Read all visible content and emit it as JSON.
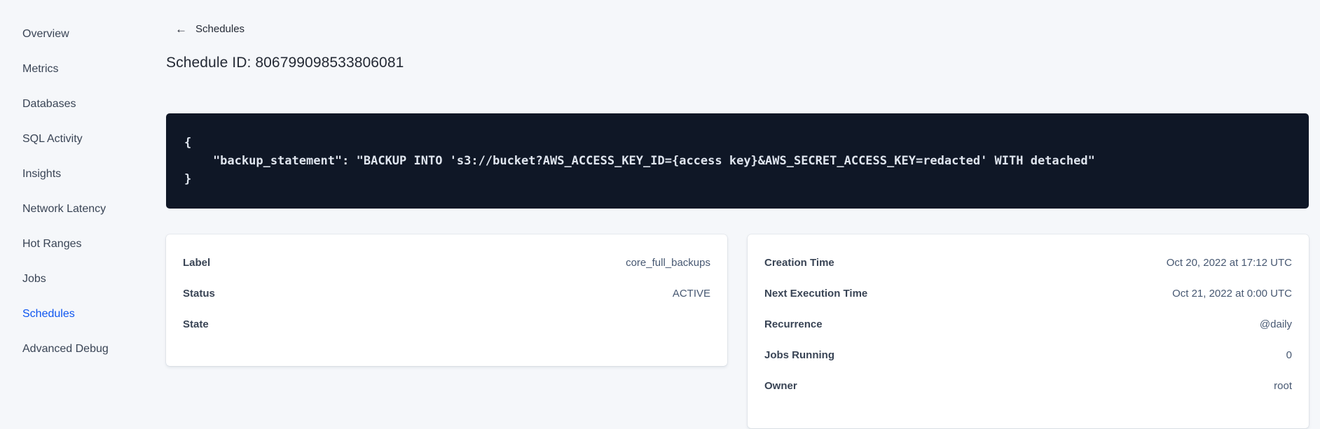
{
  "sidebar": {
    "items": [
      {
        "label": "Overview",
        "active": false
      },
      {
        "label": "Metrics",
        "active": false
      },
      {
        "label": "Databases",
        "active": false
      },
      {
        "label": "SQL Activity",
        "active": false
      },
      {
        "label": "Insights",
        "active": false
      },
      {
        "label": "Network Latency",
        "active": false
      },
      {
        "label": "Hot Ranges",
        "active": false
      },
      {
        "label": "Jobs",
        "active": false
      },
      {
        "label": "Schedules",
        "active": true
      },
      {
        "label": "Advanced Debug",
        "active": false
      }
    ]
  },
  "header": {
    "back_arrow": "←",
    "back_label": "Schedules",
    "title": "Schedule ID: 806799098533806081"
  },
  "code_block": {
    "lines": [
      "{",
      "    \"backup_statement\": \"BACKUP INTO 's3://bucket?AWS_ACCESS_KEY_ID={access key}&AWS_SECRET_ACCESS_KEY=redacted' WITH detached\"",
      "}"
    ]
  },
  "details_card": {
    "rows": [
      {
        "label": "Label",
        "value": "core_full_backups"
      },
      {
        "label": "Status",
        "value": "ACTIVE"
      },
      {
        "label": "State",
        "value": ""
      }
    ]
  },
  "schedule_card": {
    "rows": [
      {
        "label": "Creation Time",
        "value": "Oct 20, 2022 at 17:12 UTC"
      },
      {
        "label": "Next Execution Time",
        "value": "Oct 21, 2022 at 0:00 UTC"
      },
      {
        "label": "Recurrence",
        "value": "@daily"
      },
      {
        "label": "Jobs Running",
        "value": "0"
      },
      {
        "label": "Owner",
        "value": "root"
      }
    ]
  },
  "colors": {
    "page_background": "#f5f7fa",
    "sidebar_text": "#394455",
    "active_link_blue": "#0d55f0",
    "code_background": "#0f1726",
    "code_text": "#dfe5ee",
    "card_background": "#ffffff",
    "heading_text": "#242a35"
  }
}
